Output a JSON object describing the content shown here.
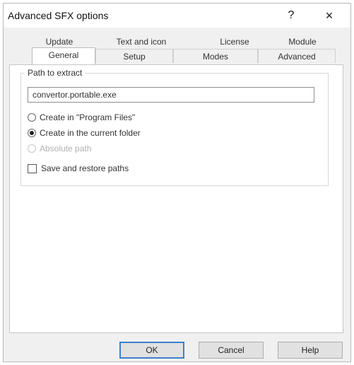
{
  "window": {
    "title": "Advanced SFX options",
    "help_glyph": "?",
    "close_glyph": "×"
  },
  "tabs": {
    "row1": [
      "Update",
      "Text and icon",
      "License",
      "Module"
    ],
    "row2": [
      "General",
      "Setup",
      "Modes",
      "Advanced"
    ],
    "active": "General"
  },
  "general": {
    "group_label": "Path to extract",
    "path_value": "convertor.portable.exe",
    "options": {
      "program_files": "Create in \"Program Files\"",
      "current_folder": "Create in the current folder",
      "absolute_path": "Absolute path",
      "save_restore": "Save and restore paths"
    },
    "selected_option": "current_folder"
  },
  "buttons": {
    "ok": "OK",
    "cancel": "Cancel",
    "help": "Help"
  },
  "colors": {
    "dialog_bg": "#f0f0f0",
    "panel_bg": "#ffffff",
    "default_button_border": "#3c7fd1"
  }
}
